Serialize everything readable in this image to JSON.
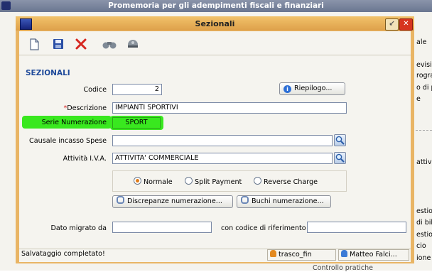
{
  "background_window": {
    "title": "Promemoria per gli adempimenti fiscali e finanziari",
    "right_texts": [
      "ale",
      "evisio",
      "rogra",
      "o di p",
      "e",
      "attiv",
      "estion",
      "di bil",
      "estion",
      "cio",
      "ione d"
    ],
    "bottom_text": "Controllo pratiche"
  },
  "dialog": {
    "title": "Sezionali",
    "title_buttons": {
      "minimize": "↙",
      "close": "✕"
    },
    "toolbar": [
      {
        "icon": "new-document-icon",
        "glyph": "🗋"
      },
      {
        "icon": "save-icon",
        "glyph": "💾"
      },
      {
        "icon": "delete-icon",
        "glyph": "✕"
      },
      {
        "icon": "binoculars-icon",
        "glyph": ""
      },
      {
        "icon": "helmet-icon",
        "glyph": ""
      }
    ],
    "section_title": "SEZIONALI",
    "fields": {
      "codice": {
        "label": "Codice",
        "value": "2"
      },
      "descrizione": {
        "label": "Descrizione",
        "required_mark": "*",
        "value": "IMPIANTI SPORTIVI"
      },
      "serie_numerazione": {
        "label": "Serie Numerazione",
        "value": "SPORT"
      },
      "causale_incasso_spese": {
        "label": "Causale incasso Spese",
        "value": ""
      },
      "attivita_iva": {
        "label": "Attività I.V.A.",
        "value": "ATTIVITA' COMMERCIALE"
      },
      "dato_migrato_da": {
        "label": "Dato migrato da",
        "value": ""
      },
      "codice_riferimento": {
        "label": "con codice di riferimento",
        "value": ""
      }
    },
    "buttons": {
      "riepilogo": "Riepilogo...",
      "discrepanze": "Discrepanze numerazione...",
      "buchi": "Buchi numerazione..."
    },
    "radio_options": [
      {
        "label": "Normale",
        "selected": true
      },
      {
        "label": "Split Payment",
        "selected": false
      },
      {
        "label": "Reverse Charge",
        "selected": false
      }
    ],
    "status_bar": {
      "message": "Salvataggio completato!",
      "db": "trasco_fin",
      "user": "Matteo Falci..."
    }
  },
  "colors": {
    "dialog_frame": "#e9b565",
    "highlight": "#39e81f",
    "section_title": "#1f4a9a",
    "required_mark": "#d71f1f"
  }
}
